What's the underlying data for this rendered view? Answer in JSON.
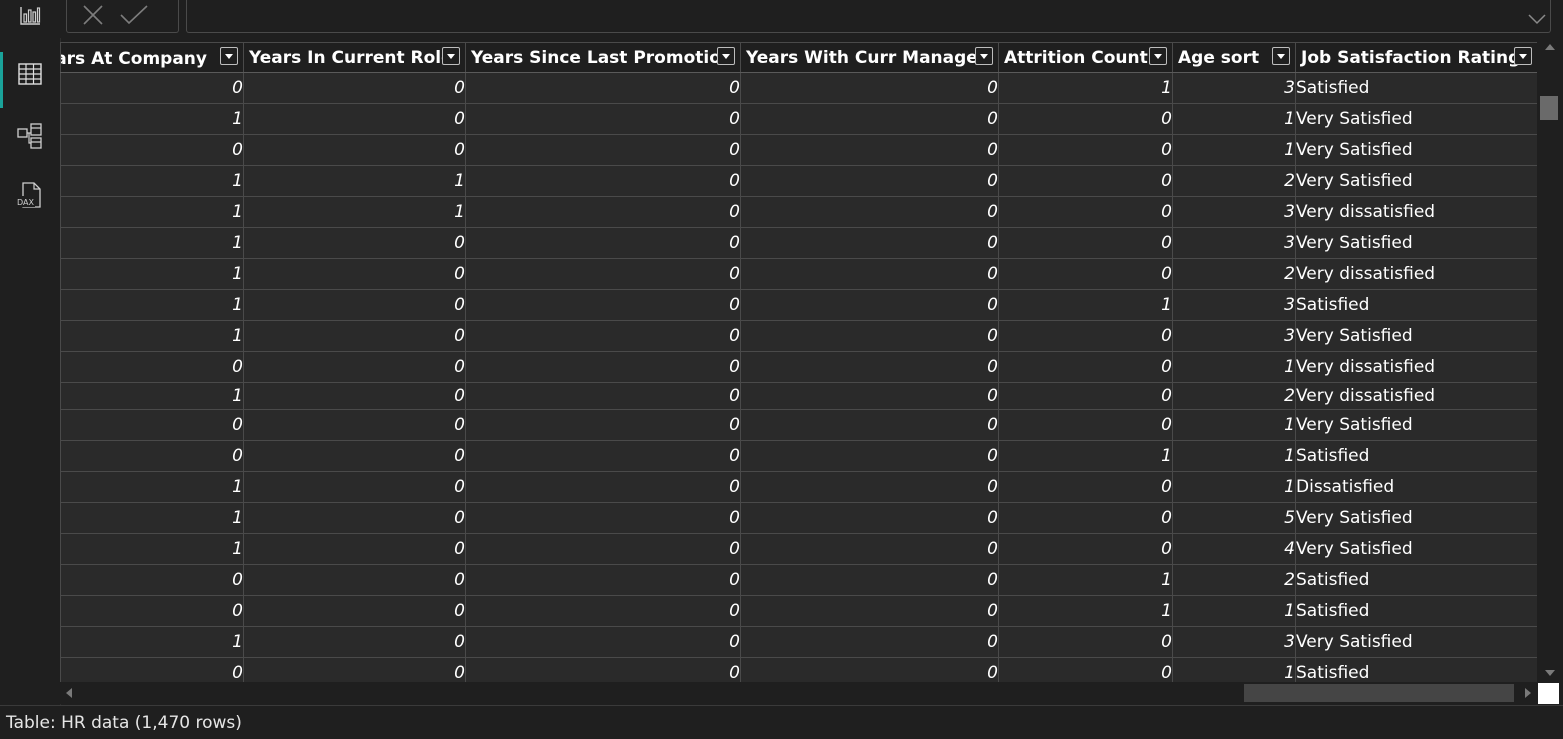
{
  "rail": {
    "items": [
      {
        "name": "report-view-icon"
      },
      {
        "name": "table-view-icon",
        "active": true
      },
      {
        "name": "model-view-icon"
      },
      {
        "name": "dax-query-view-icon",
        "label": "DAX"
      }
    ]
  },
  "formula_bar": {
    "value": ""
  },
  "grid": {
    "columns": [
      "ears At Company",
      "Years In Current Role",
      "Years Since Last Promotion",
      "Years With Curr Manager",
      "Attrition Count",
      "Age  sort",
      "Job Satisfaction Rating"
    ],
    "rows": [
      [
        "0",
        "0",
        "0",
        "0",
        "1",
        "3",
        "Satisfied"
      ],
      [
        "1",
        "0",
        "0",
        "0",
        "0",
        "1",
        "Very Satisfied"
      ],
      [
        "0",
        "0",
        "0",
        "0",
        "0",
        "1",
        "Very Satisfied"
      ],
      [
        "1",
        "1",
        "0",
        "0",
        "0",
        "2",
        "Very Satisfied"
      ],
      [
        "1",
        "1",
        "0",
        "0",
        "0",
        "3",
        "Very dissatisfied"
      ],
      [
        "1",
        "0",
        "0",
        "0",
        "0",
        "3",
        "Very Satisfied"
      ],
      [
        "1",
        "0",
        "0",
        "0",
        "0",
        "2",
        "Very dissatisfied"
      ],
      [
        "1",
        "0",
        "0",
        "0",
        "1",
        "3",
        "Satisfied"
      ],
      [
        "1",
        "0",
        "0",
        "0",
        "0",
        "3",
        "Very Satisfied"
      ],
      [
        "0",
        "0",
        "0",
        "0",
        "0",
        "1",
        "Very dissatisfied"
      ],
      [
        "1",
        "0",
        "0",
        "0",
        "0",
        "2",
        "Very dissatisfied"
      ],
      [
        "0",
        "0",
        "0",
        "0",
        "0",
        "1",
        "Very Satisfied"
      ],
      [
        "0",
        "0",
        "0",
        "0",
        "1",
        "1",
        "Satisfied"
      ],
      [
        "1",
        "0",
        "0",
        "0",
        "0",
        "1",
        "Dissatisfied"
      ],
      [
        "1",
        "0",
        "0",
        "0",
        "0",
        "5",
        "Very Satisfied"
      ],
      [
        "1",
        "0",
        "0",
        "0",
        "0",
        "4",
        "Very Satisfied"
      ],
      [
        "0",
        "0",
        "0",
        "0",
        "1",
        "2",
        "Satisfied"
      ],
      [
        "0",
        "0",
        "0",
        "0",
        "1",
        "1",
        "Satisfied"
      ],
      [
        "1",
        "0",
        "0",
        "0",
        "0",
        "3",
        "Very Satisfied"
      ],
      [
        "0",
        "0",
        "0",
        "0",
        "0",
        "1",
        "Satisfied"
      ]
    ]
  },
  "status_bar": {
    "text": "Table: HR data (1,470 rows)"
  },
  "colors": {
    "accent": "#1aa39a",
    "background": "#1f1f1f",
    "cell": "#2a2a2a",
    "gridline": "#4a4a4a"
  }
}
